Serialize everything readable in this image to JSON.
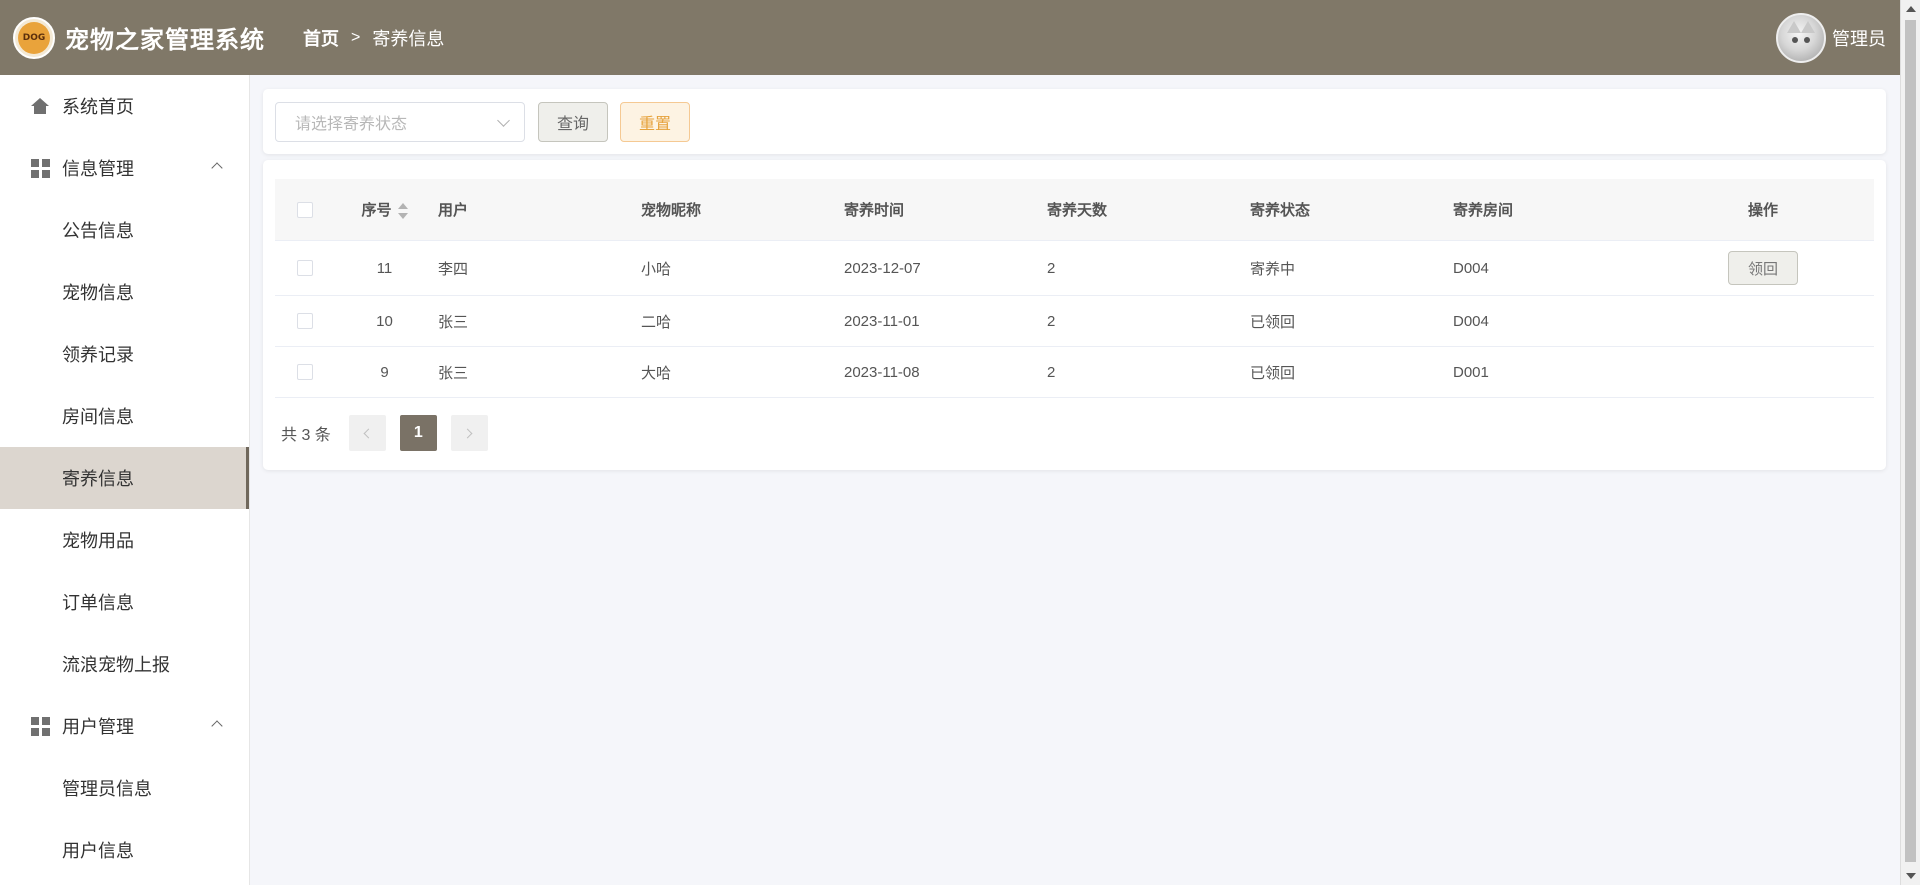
{
  "header": {
    "logo_text": "DOG",
    "app_title": "宠物之家管理系统",
    "breadcrumb": {
      "home": "首页",
      "current": "寄养信息"
    },
    "user_name": "管理员"
  },
  "sidebar": {
    "home": "系统首页",
    "info_group": {
      "label": "信息管理",
      "items": [
        "公告信息",
        "宠物信息",
        "领养记录",
        "房间信息",
        "寄养信息",
        "宠物用品",
        "订单信息",
        "流浪宠物上报"
      ]
    },
    "user_group": {
      "label": "用户管理",
      "items": [
        "管理员信息",
        "用户信息"
      ]
    },
    "active_item": "寄养信息"
  },
  "search": {
    "status_placeholder": "请选择寄养状态",
    "query_label": "查询",
    "reset_label": "重置"
  },
  "table": {
    "columns": [
      "序号",
      "用户",
      "宠物昵称",
      "寄养时间",
      "寄养天数",
      "寄养状态",
      "寄养房间",
      "操作"
    ],
    "rows": [
      {
        "id": "11",
        "user": "李四",
        "pet": "小哈",
        "time": "2023-12-07",
        "days": "2",
        "status": "寄养中",
        "room": "D004",
        "action": "领回"
      },
      {
        "id": "10",
        "user": "张三",
        "pet": "二哈",
        "time": "2023-11-01",
        "days": "2",
        "status": "已领回",
        "room": "D004",
        "action": ""
      },
      {
        "id": "9",
        "user": "张三",
        "pet": "大哈",
        "time": "2023-11-08",
        "days": "2",
        "status": "已领回",
        "room": "D001",
        "action": ""
      }
    ]
  },
  "pagination": {
    "total_text": "共 3 条",
    "current_page": "1"
  },
  "colors": {
    "header_bg": "#807868",
    "active_menu_bg": "#dcd6cf",
    "accent": "#7a7266",
    "reset_text": "#e6a23c"
  }
}
